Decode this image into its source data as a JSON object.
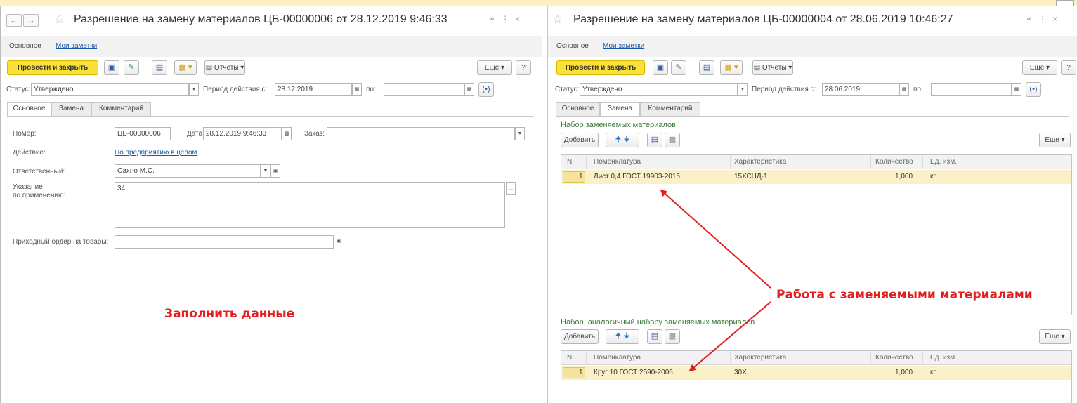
{
  "left": {
    "title": "Разрешение на замену материалов ЦБ-00000006 от 28.12.2019 9:46:33",
    "nav_tabs": {
      "main": "Основное",
      "notes": "Мои заметки"
    },
    "toolbar": {
      "post_close": "Провести и закрыть",
      "reports": "Отчеты",
      "more": "Еще",
      "help": "?"
    },
    "status_label": "Статус:",
    "status_value": "Утверждено",
    "period_label": "Период действия с:",
    "period_from": "28.12.2019",
    "period_to_label": "по:",
    "period_to_placeholder": ". .",
    "form_tabs": [
      "Основное",
      "Замена",
      "Комментарий"
    ],
    "fields": {
      "number_label": "Номер:",
      "number_value": "ЦБ-00000006",
      "date_label": "Дата:",
      "date_value": "28.12.2019  9:46:33",
      "order_label": "Заказ:",
      "action_label": "Действие:",
      "action_value": "По предприятию в целом",
      "responsible_label": "Ответственный:",
      "responsible_value": "Сахно М.С.",
      "instruction_label_1": "Указание",
      "instruction_label_2": "по применению:",
      "instruction_value": "34",
      "receipt_label": "Приходный ордер на товары:"
    },
    "annotation": "Заполнить данные"
  },
  "right": {
    "title": "Разрешение на замену материалов ЦБ-00000004 от 28.06.2019 10:46:27",
    "nav_tabs": {
      "main": "Основное",
      "notes": "Мои заметки"
    },
    "toolbar": {
      "post_close": "Провести и закрыть",
      "reports": "Отчеты",
      "more": "Еще",
      "help": "?"
    },
    "status_label": "Статус:",
    "status_value": "Утверждено",
    "period_label": "Период действия с:",
    "period_from": "28.06.2019",
    "period_to_label": "по:",
    "period_to_placeholder": ". .",
    "form_tabs": [
      "Основное",
      "Замена",
      "Комментарий"
    ],
    "replaced_set": {
      "title": "Набор заменяемых материалов",
      "add": "Добавить",
      "more": "Еще",
      "columns": [
        "N",
        "Номенклатура",
        "Характеристика",
        "Количество",
        "Ед. изм."
      ],
      "rows": [
        {
          "n": "1",
          "item": "Лист 0,4 ГОСТ 19903-2015",
          "characteristic": "15ХСНД-1",
          "qty": "1,000",
          "unit": "кг"
        }
      ]
    },
    "analog_set": {
      "title": "Набор, аналогичный набору заменяемых материалов",
      "add": "Добавить",
      "more": "Еще",
      "columns": [
        "N",
        "Номенклатура",
        "Характеристика",
        "Количество",
        "Ед. изм."
      ],
      "rows": [
        {
          "n": "1",
          "item": "Круг 10 ГОСТ 2590-2006",
          "characteristic": "30Х",
          "qty": "1,000",
          "unit": "кг"
        }
      ]
    },
    "annotation": "Работа с заменяемыми материалами"
  },
  "colors": {
    "primary_button": "#fae13a",
    "section_title": "#3c7a3c",
    "annotation": "#e02020",
    "selected_row": "#fbf1c8",
    "link": "#1a5aa5"
  }
}
